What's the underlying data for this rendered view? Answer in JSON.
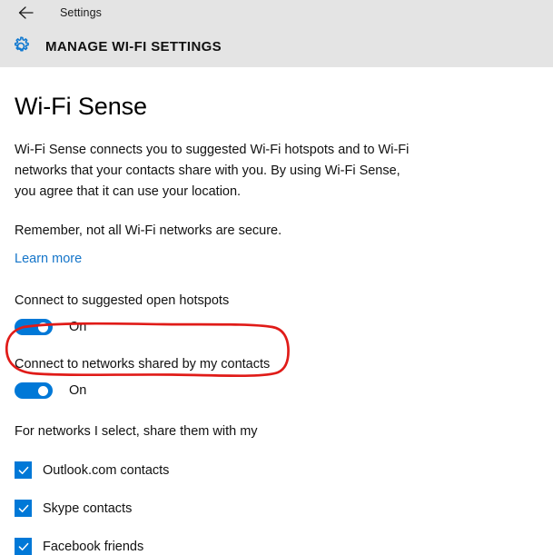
{
  "titlebar": {
    "back_icon": "back-arrow-icon",
    "label": "Settings"
  },
  "header": {
    "icon": "gear-icon",
    "title": "MANAGE WI-FI SETTINGS"
  },
  "page": {
    "title": "Wi-Fi Sense",
    "description": "Wi-Fi Sense connects you to suggested Wi-Fi hotspots and to Wi-Fi networks that your contacts share with you. By using Wi-Fi Sense, you agree that it can use your location.",
    "note": "Remember, not all Wi-Fi networks are secure.",
    "learn_more": "Learn more"
  },
  "settings": [
    {
      "label": "Connect to suggested open hotspots",
      "state": "On",
      "checked": true
    },
    {
      "label": "Connect to networks shared by my contacts",
      "state": "On",
      "checked": true,
      "annotated": true
    }
  ],
  "sharing": {
    "intro": "For networks I select, share them with my",
    "options": [
      {
        "label": "Outlook.com contacts",
        "checked": true
      },
      {
        "label": "Skype contacts",
        "checked": true
      },
      {
        "label": "Facebook friends",
        "checked": true
      }
    ]
  },
  "colors": {
    "accent": "#0078d7",
    "link": "#1575c9",
    "header_band": "#e4e4e4",
    "annotation": "#e01b18",
    "text": "#111111"
  },
  "annotation": {
    "shape": "hand-drawn-rounded-rectangle",
    "target": "Connect to networks shared by my contacts"
  }
}
